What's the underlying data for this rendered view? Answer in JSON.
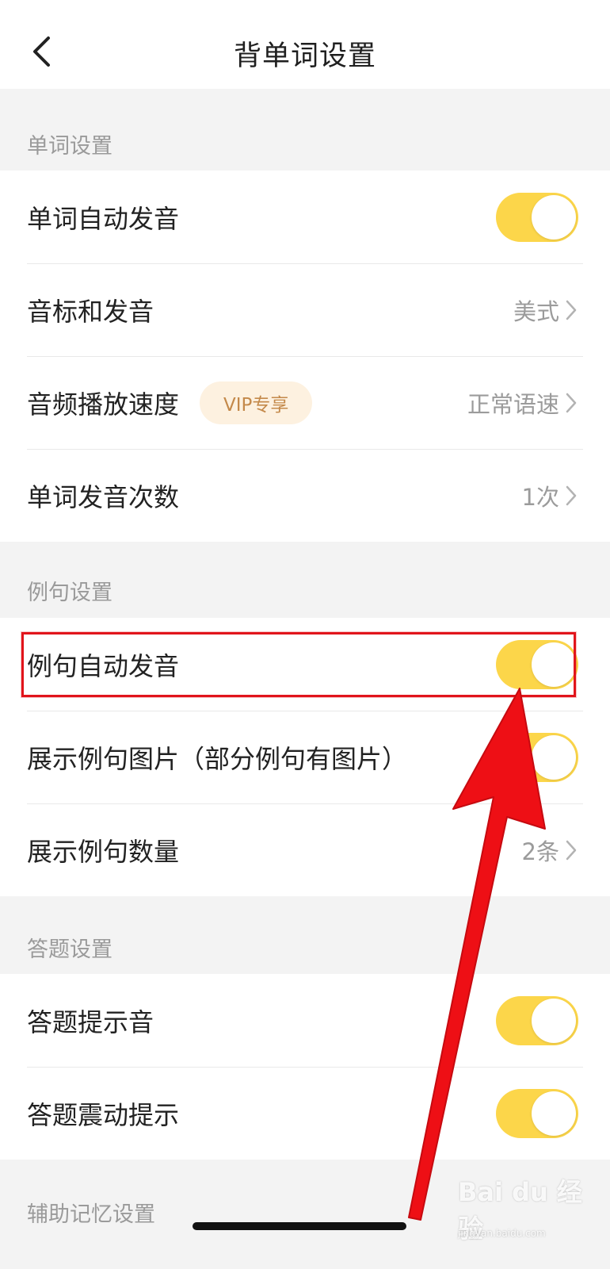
{
  "header": {
    "title": "背单词设置"
  },
  "sections": [
    {
      "title": "单词设置"
    },
    {
      "title": "例句设置"
    },
    {
      "title": "答题设置"
    },
    {
      "title": "辅助记忆设置"
    }
  ],
  "word_settings": {
    "auto_pronounce": {
      "label": "单词自动发音",
      "state": "on"
    },
    "phonetic": {
      "label": "音标和发音",
      "value": "美式"
    },
    "audio_speed": {
      "label": "音频播放速度",
      "badge": "VIP专享",
      "value": "正常语速"
    },
    "pronounce_count": {
      "label": "单词发音次数",
      "value": "1次"
    }
  },
  "example_settings": {
    "auto_pronounce": {
      "label": "例句自动发音",
      "state": "on"
    },
    "show_images": {
      "label": "展示例句图片（部分例句有图片）",
      "state": "on"
    },
    "example_count": {
      "label": "展示例句数量",
      "value": "2条"
    }
  },
  "answer_settings": {
    "sound": {
      "label": "答题提示音",
      "state": "on"
    },
    "vibration": {
      "label": "答题震动提示",
      "state": "on"
    }
  },
  "colors": {
    "toggle_on": "#fcd64a",
    "annotation": "#e1141b",
    "vip_text": "#c4894a"
  },
  "watermark": {
    "text": "Bai du 经验",
    "sub": "jingyan.baidu.com"
  }
}
